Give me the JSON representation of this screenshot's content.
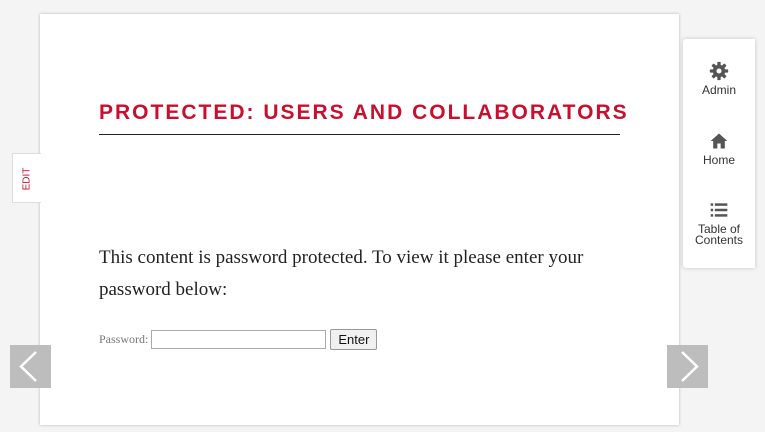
{
  "page": {
    "title": "PROTECTED: USERS AND COLLABORATORS",
    "message": "This content is password protected. To view it please enter your password below:"
  },
  "form": {
    "password_label": "Password:",
    "password_value": "",
    "enter_label": "Enter"
  },
  "edit_tab": {
    "label": "EDIT"
  },
  "side_nav": {
    "admin_label": "Admin",
    "home_label": "Home",
    "toc_label_line1": "Table of",
    "toc_label_line2": "Contents"
  },
  "icons": {
    "admin": "gear-icon",
    "home": "home-icon",
    "toc": "list-icon",
    "prev": "chevron-left-icon",
    "next": "chevron-right-icon"
  },
  "colors": {
    "title": "#c8102e",
    "arrow_bg": "#bdbdbd",
    "page_bg": "#ffffff",
    "body_bg": "#f4f4f4"
  }
}
